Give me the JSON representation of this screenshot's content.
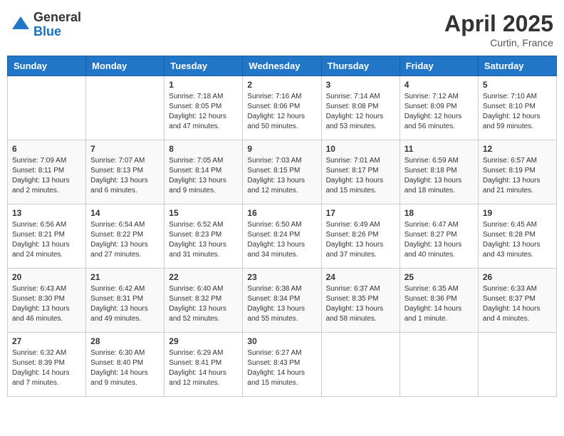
{
  "header": {
    "logo_general": "General",
    "logo_blue": "Blue",
    "month_title": "April 2025",
    "location": "Curtin, France"
  },
  "weekdays": [
    "Sunday",
    "Monday",
    "Tuesday",
    "Wednesday",
    "Thursday",
    "Friday",
    "Saturday"
  ],
  "weeks": [
    [
      {
        "day": "",
        "sunrise": "",
        "sunset": "",
        "daylight": ""
      },
      {
        "day": "",
        "sunrise": "",
        "sunset": "",
        "daylight": ""
      },
      {
        "day": "1",
        "sunrise": "Sunrise: 7:18 AM",
        "sunset": "Sunset: 8:05 PM",
        "daylight": "Daylight: 12 hours and 47 minutes."
      },
      {
        "day": "2",
        "sunrise": "Sunrise: 7:16 AM",
        "sunset": "Sunset: 8:06 PM",
        "daylight": "Daylight: 12 hours and 50 minutes."
      },
      {
        "day": "3",
        "sunrise": "Sunrise: 7:14 AM",
        "sunset": "Sunset: 8:08 PM",
        "daylight": "Daylight: 12 hours and 53 minutes."
      },
      {
        "day": "4",
        "sunrise": "Sunrise: 7:12 AM",
        "sunset": "Sunset: 8:09 PM",
        "daylight": "Daylight: 12 hours and 56 minutes."
      },
      {
        "day": "5",
        "sunrise": "Sunrise: 7:10 AM",
        "sunset": "Sunset: 8:10 PM",
        "daylight": "Daylight: 12 hours and 59 minutes."
      }
    ],
    [
      {
        "day": "6",
        "sunrise": "Sunrise: 7:09 AM",
        "sunset": "Sunset: 8:11 PM",
        "daylight": "Daylight: 13 hours and 2 minutes."
      },
      {
        "day": "7",
        "sunrise": "Sunrise: 7:07 AM",
        "sunset": "Sunset: 8:13 PM",
        "daylight": "Daylight: 13 hours and 6 minutes."
      },
      {
        "day": "8",
        "sunrise": "Sunrise: 7:05 AM",
        "sunset": "Sunset: 8:14 PM",
        "daylight": "Daylight: 13 hours and 9 minutes."
      },
      {
        "day": "9",
        "sunrise": "Sunrise: 7:03 AM",
        "sunset": "Sunset: 8:15 PM",
        "daylight": "Daylight: 13 hours and 12 minutes."
      },
      {
        "day": "10",
        "sunrise": "Sunrise: 7:01 AM",
        "sunset": "Sunset: 8:17 PM",
        "daylight": "Daylight: 13 hours and 15 minutes."
      },
      {
        "day": "11",
        "sunrise": "Sunrise: 6:59 AM",
        "sunset": "Sunset: 8:18 PM",
        "daylight": "Daylight: 13 hours and 18 minutes."
      },
      {
        "day": "12",
        "sunrise": "Sunrise: 6:57 AM",
        "sunset": "Sunset: 8:19 PM",
        "daylight": "Daylight: 13 hours and 21 minutes."
      }
    ],
    [
      {
        "day": "13",
        "sunrise": "Sunrise: 6:56 AM",
        "sunset": "Sunset: 8:21 PM",
        "daylight": "Daylight: 13 hours and 24 minutes."
      },
      {
        "day": "14",
        "sunrise": "Sunrise: 6:54 AM",
        "sunset": "Sunset: 8:22 PM",
        "daylight": "Daylight: 13 hours and 27 minutes."
      },
      {
        "day": "15",
        "sunrise": "Sunrise: 6:52 AM",
        "sunset": "Sunset: 8:23 PM",
        "daylight": "Daylight: 13 hours and 31 minutes."
      },
      {
        "day": "16",
        "sunrise": "Sunrise: 6:50 AM",
        "sunset": "Sunset: 8:24 PM",
        "daylight": "Daylight: 13 hours and 34 minutes."
      },
      {
        "day": "17",
        "sunrise": "Sunrise: 6:49 AM",
        "sunset": "Sunset: 8:26 PM",
        "daylight": "Daylight: 13 hours and 37 minutes."
      },
      {
        "day": "18",
        "sunrise": "Sunrise: 6:47 AM",
        "sunset": "Sunset: 8:27 PM",
        "daylight": "Daylight: 13 hours and 40 minutes."
      },
      {
        "day": "19",
        "sunrise": "Sunrise: 6:45 AM",
        "sunset": "Sunset: 8:28 PM",
        "daylight": "Daylight: 13 hours and 43 minutes."
      }
    ],
    [
      {
        "day": "20",
        "sunrise": "Sunrise: 6:43 AM",
        "sunset": "Sunset: 8:30 PM",
        "daylight": "Daylight: 13 hours and 46 minutes."
      },
      {
        "day": "21",
        "sunrise": "Sunrise: 6:42 AM",
        "sunset": "Sunset: 8:31 PM",
        "daylight": "Daylight: 13 hours and 49 minutes."
      },
      {
        "day": "22",
        "sunrise": "Sunrise: 6:40 AM",
        "sunset": "Sunset: 8:32 PM",
        "daylight": "Daylight: 13 hours and 52 minutes."
      },
      {
        "day": "23",
        "sunrise": "Sunrise: 6:38 AM",
        "sunset": "Sunset: 8:34 PM",
        "daylight": "Daylight: 13 hours and 55 minutes."
      },
      {
        "day": "24",
        "sunrise": "Sunrise: 6:37 AM",
        "sunset": "Sunset: 8:35 PM",
        "daylight": "Daylight: 13 hours and 58 minutes."
      },
      {
        "day": "25",
        "sunrise": "Sunrise: 6:35 AM",
        "sunset": "Sunset: 8:36 PM",
        "daylight": "Daylight: 14 hours and 1 minute."
      },
      {
        "day": "26",
        "sunrise": "Sunrise: 6:33 AM",
        "sunset": "Sunset: 8:37 PM",
        "daylight": "Daylight: 14 hours and 4 minutes."
      }
    ],
    [
      {
        "day": "27",
        "sunrise": "Sunrise: 6:32 AM",
        "sunset": "Sunset: 8:39 PM",
        "daylight": "Daylight: 14 hours and 7 minutes."
      },
      {
        "day": "28",
        "sunrise": "Sunrise: 6:30 AM",
        "sunset": "Sunset: 8:40 PM",
        "daylight": "Daylight: 14 hours and 9 minutes."
      },
      {
        "day": "29",
        "sunrise": "Sunrise: 6:29 AM",
        "sunset": "Sunset: 8:41 PM",
        "daylight": "Daylight: 14 hours and 12 minutes."
      },
      {
        "day": "30",
        "sunrise": "Sunrise: 6:27 AM",
        "sunset": "Sunset: 8:43 PM",
        "daylight": "Daylight: 14 hours and 15 minutes."
      },
      {
        "day": "",
        "sunrise": "",
        "sunset": "",
        "daylight": ""
      },
      {
        "day": "",
        "sunrise": "",
        "sunset": "",
        "daylight": ""
      },
      {
        "day": "",
        "sunrise": "",
        "sunset": "",
        "daylight": ""
      }
    ]
  ]
}
